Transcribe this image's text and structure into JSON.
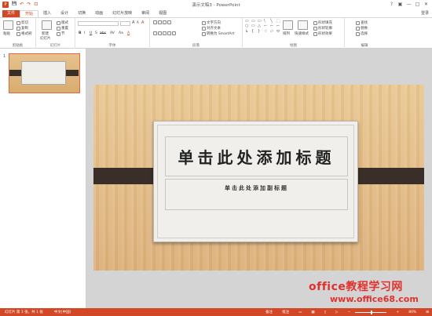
{
  "window": {
    "title": "演示文稿3 - PowerPoint"
  },
  "qat": {
    "save": "💾",
    "undo": "↶",
    "redo": "↷",
    "start": "⊡"
  },
  "window_controls": {
    "help": "?",
    "ribbon_options": "▣",
    "minimize": "—",
    "maximize": "□",
    "close": "✕"
  },
  "tabs": [
    "文件",
    "开始",
    "插入",
    "设计",
    "切换",
    "动画",
    "幻灯片放映",
    "审阅",
    "视图"
  ],
  "account": {
    "label": "登录"
  },
  "ribbon": {
    "clipboard": {
      "label": "剪贴板",
      "paste": "粘贴",
      "cut": "剪切",
      "copy": "复制",
      "format_painter": "格式刷"
    },
    "slides": {
      "label": "幻灯片",
      "new_slide": "新建",
      "new_slide2": "幻灯片",
      "layout": "版式",
      "reset": "重置",
      "section": "节"
    },
    "font": {
      "label": "字体",
      "font_name": "",
      "font_size": "",
      "bold": "B",
      "italic": "I",
      "underline": "U",
      "strike": "S",
      "shadow": "abc",
      "spacing": "AV",
      "case": "Aa",
      "color": "A",
      "grow": "A",
      "shrink": "A",
      "clear": "A"
    },
    "paragraph": {
      "label": "段落",
      "text_direction": "文字方向",
      "align_text": "对齐文本",
      "smartart": "转换为 SmartArt"
    },
    "drawing": {
      "label": "绘图",
      "arrange": "排列",
      "quick_styles": "快速样式",
      "fill": "形状填充",
      "outline": "形状轮廓",
      "effects": "形状效果"
    },
    "editing": {
      "label": "编辑",
      "find": "查找",
      "replace": "替换",
      "select": "选择"
    }
  },
  "shapes": [
    "▭",
    "▭",
    "▭",
    "\\",
    "╲",
    "⬚",
    "○",
    "▭",
    "△",
    "⌐",
    "⌐",
    "⌐",
    "↳",
    "{",
    "}",
    "☆",
    "▱",
    "⬭"
  ],
  "slides_pane": {
    "number": "1"
  },
  "slide": {
    "title": "单击此处添加标题",
    "subtitle": "单击此处添加副标题"
  },
  "watermark": {
    "line1": "office教程学习网",
    "line2": "www.office68.com"
  },
  "status": {
    "slide": "幻灯片 第 1 张，共 1 张",
    "lang": "中文(中国)",
    "notes": "备注",
    "comments": "批注",
    "zoom": "80%",
    "zoom_level": 0.5,
    "minus": "−",
    "plus": "+"
  },
  "colors": {
    "accent": "#d24726",
    "band": "#3a2e28",
    "watermark": "#e0322d"
  }
}
